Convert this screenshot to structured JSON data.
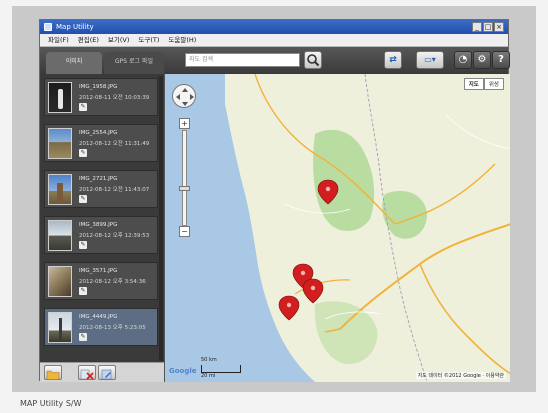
{
  "window": {
    "title": "Map Utility",
    "min_icon": "_",
    "max_icon": "□",
    "close_icon": "×"
  },
  "menu": [
    "파일(F)",
    "편집(E)",
    "보기(V)",
    "도구(T)",
    "도움말(H)"
  ],
  "tabs": {
    "images": "이미지",
    "gps": "GPS 로그 파일"
  },
  "search": {
    "placeholder": "지도 검색"
  },
  "toolbar_icons": {
    "export": "⇄",
    "view": "▭▾",
    "tools": "◔",
    "settings": "⚙",
    "help": "?"
  },
  "images": [
    {
      "name": "IMG_1958.JPG",
      "date": "2012-08-11 오전 10:03:39"
    },
    {
      "name": "IMG_2554.JPG",
      "date": "2012-08-12 오전 11:31:49"
    },
    {
      "name": "IMG_2721.JPG",
      "date": "2012-08-12 오전 11:43:07"
    },
    {
      "name": "IMG_3899.JPG",
      "date": "2012-08-12 오후 12:39:53"
    },
    {
      "name": "IMG_3571.JPG",
      "date": "2012-08-12 오후 3:54:36"
    },
    {
      "name": "IMG_4449.JPG",
      "date": "2012-08-13 오후 5:23:05"
    }
  ],
  "map": {
    "type_map": "지도",
    "type_satellite": "위성",
    "scale_km": "50 km",
    "scale_mi": "20 mi",
    "logo": "Google",
    "attribution": "지도 데이터 ©2012 Google · 이용약관",
    "zoom_in": "+",
    "zoom_out": "−"
  },
  "colors": {
    "water": "#a8c8e6",
    "land": "#eef0dc",
    "park": "#b9dca0",
    "road_major": "#f2b23a",
    "border": "#9b8fb0",
    "marker": "#d11f1f"
  },
  "caption": "MAP Utility S/W"
}
